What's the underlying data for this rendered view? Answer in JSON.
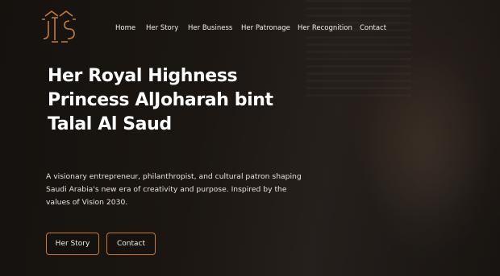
{
  "nav": {
    "items": [
      "Home",
      "Her Story",
      "Her Business",
      "Her Patronage",
      "Her Recognition",
      "Contact"
    ]
  },
  "hero": {
    "title_lines": [
      "Her Royal Highness",
      "Princess AlJoharah bint",
      "Talal Al Saud"
    ],
    "description": "A visionary entrepreneur, philanthropist, and cultural patron shaping Saudi Arabia's new era of creativity and purpose. Inspired by the values of Vision 2030.",
    "buttons": {
      "story_label": "Her Story",
      "contact_label": "Contact"
    }
  },
  "colors": {
    "accent": "#c87a35",
    "background": "#1a1410",
    "text": "#ffffff"
  },
  "icons": {
    "logo": "monogram-logo"
  }
}
